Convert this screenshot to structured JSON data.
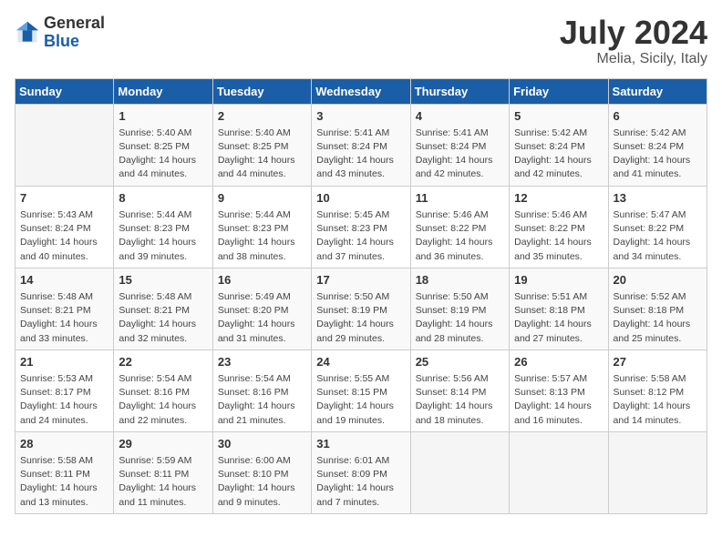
{
  "header": {
    "logo_general": "General",
    "logo_blue": "Blue",
    "title": "July 2024",
    "location": "Melia, Sicily, Italy"
  },
  "days_of_week": [
    "Sunday",
    "Monday",
    "Tuesday",
    "Wednesday",
    "Thursday",
    "Friday",
    "Saturday"
  ],
  "weeks": [
    [
      {
        "day": "",
        "info": ""
      },
      {
        "day": "1",
        "info": "Sunrise: 5:40 AM\nSunset: 8:25 PM\nDaylight: 14 hours\nand 44 minutes."
      },
      {
        "day": "2",
        "info": "Sunrise: 5:40 AM\nSunset: 8:25 PM\nDaylight: 14 hours\nand 44 minutes."
      },
      {
        "day": "3",
        "info": "Sunrise: 5:41 AM\nSunset: 8:24 PM\nDaylight: 14 hours\nand 43 minutes."
      },
      {
        "day": "4",
        "info": "Sunrise: 5:41 AM\nSunset: 8:24 PM\nDaylight: 14 hours\nand 42 minutes."
      },
      {
        "day": "5",
        "info": "Sunrise: 5:42 AM\nSunset: 8:24 PM\nDaylight: 14 hours\nand 42 minutes."
      },
      {
        "day": "6",
        "info": "Sunrise: 5:42 AM\nSunset: 8:24 PM\nDaylight: 14 hours\nand 41 minutes."
      }
    ],
    [
      {
        "day": "7",
        "info": "Sunrise: 5:43 AM\nSunset: 8:24 PM\nDaylight: 14 hours\nand 40 minutes."
      },
      {
        "day": "8",
        "info": "Sunrise: 5:44 AM\nSunset: 8:23 PM\nDaylight: 14 hours\nand 39 minutes."
      },
      {
        "day": "9",
        "info": "Sunrise: 5:44 AM\nSunset: 8:23 PM\nDaylight: 14 hours\nand 38 minutes."
      },
      {
        "day": "10",
        "info": "Sunrise: 5:45 AM\nSunset: 8:23 PM\nDaylight: 14 hours\nand 37 minutes."
      },
      {
        "day": "11",
        "info": "Sunrise: 5:46 AM\nSunset: 8:22 PM\nDaylight: 14 hours\nand 36 minutes."
      },
      {
        "day": "12",
        "info": "Sunrise: 5:46 AM\nSunset: 8:22 PM\nDaylight: 14 hours\nand 35 minutes."
      },
      {
        "day": "13",
        "info": "Sunrise: 5:47 AM\nSunset: 8:22 PM\nDaylight: 14 hours\nand 34 minutes."
      }
    ],
    [
      {
        "day": "14",
        "info": "Sunrise: 5:48 AM\nSunset: 8:21 PM\nDaylight: 14 hours\nand 33 minutes."
      },
      {
        "day": "15",
        "info": "Sunrise: 5:48 AM\nSunset: 8:21 PM\nDaylight: 14 hours\nand 32 minutes."
      },
      {
        "day": "16",
        "info": "Sunrise: 5:49 AM\nSunset: 8:20 PM\nDaylight: 14 hours\nand 31 minutes."
      },
      {
        "day": "17",
        "info": "Sunrise: 5:50 AM\nSunset: 8:19 PM\nDaylight: 14 hours\nand 29 minutes."
      },
      {
        "day": "18",
        "info": "Sunrise: 5:50 AM\nSunset: 8:19 PM\nDaylight: 14 hours\nand 28 minutes."
      },
      {
        "day": "19",
        "info": "Sunrise: 5:51 AM\nSunset: 8:18 PM\nDaylight: 14 hours\nand 27 minutes."
      },
      {
        "day": "20",
        "info": "Sunrise: 5:52 AM\nSunset: 8:18 PM\nDaylight: 14 hours\nand 25 minutes."
      }
    ],
    [
      {
        "day": "21",
        "info": "Sunrise: 5:53 AM\nSunset: 8:17 PM\nDaylight: 14 hours\nand 24 minutes."
      },
      {
        "day": "22",
        "info": "Sunrise: 5:54 AM\nSunset: 8:16 PM\nDaylight: 14 hours\nand 22 minutes."
      },
      {
        "day": "23",
        "info": "Sunrise: 5:54 AM\nSunset: 8:16 PM\nDaylight: 14 hours\nand 21 minutes."
      },
      {
        "day": "24",
        "info": "Sunrise: 5:55 AM\nSunset: 8:15 PM\nDaylight: 14 hours\nand 19 minutes."
      },
      {
        "day": "25",
        "info": "Sunrise: 5:56 AM\nSunset: 8:14 PM\nDaylight: 14 hours\nand 18 minutes."
      },
      {
        "day": "26",
        "info": "Sunrise: 5:57 AM\nSunset: 8:13 PM\nDaylight: 14 hours\nand 16 minutes."
      },
      {
        "day": "27",
        "info": "Sunrise: 5:58 AM\nSunset: 8:12 PM\nDaylight: 14 hours\nand 14 minutes."
      }
    ],
    [
      {
        "day": "28",
        "info": "Sunrise: 5:58 AM\nSunset: 8:11 PM\nDaylight: 14 hours\nand 13 minutes."
      },
      {
        "day": "29",
        "info": "Sunrise: 5:59 AM\nSunset: 8:11 PM\nDaylight: 14 hours\nand 11 minutes."
      },
      {
        "day": "30",
        "info": "Sunrise: 6:00 AM\nSunset: 8:10 PM\nDaylight: 14 hours\nand 9 minutes."
      },
      {
        "day": "31",
        "info": "Sunrise: 6:01 AM\nSunset: 8:09 PM\nDaylight: 14 hours\nand 7 minutes."
      },
      {
        "day": "",
        "info": ""
      },
      {
        "day": "",
        "info": ""
      },
      {
        "day": "",
        "info": ""
      }
    ]
  ]
}
